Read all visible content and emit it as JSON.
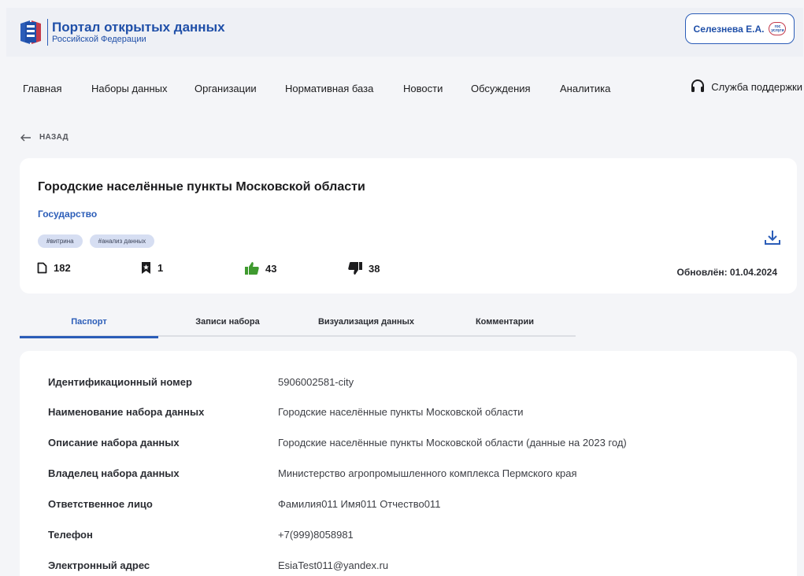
{
  "header": {
    "portal_title": "Портал открытых данных",
    "portal_subtitle": "Российской Федерации",
    "user_name": "Селезнева Е.А.",
    "gos_badge_text": "гос услуги"
  },
  "nav": {
    "items": [
      {
        "label": "Главная"
      },
      {
        "label": "Наборы данных"
      },
      {
        "label": "Организации"
      },
      {
        "label": "Нормативная база"
      },
      {
        "label": "Новости"
      },
      {
        "label": "Обсуждения"
      },
      {
        "label": "Аналитика"
      }
    ],
    "support_label": "Служба поддержки"
  },
  "back_label": "НАЗАД",
  "dataset": {
    "title": "Городские населённые пункты Московской области",
    "category": "Государство",
    "tags": [
      "#витрина",
      "#анализ данных"
    ],
    "stats": {
      "files": "182",
      "bookmarks": "1",
      "likes": "43",
      "dislikes": "38"
    },
    "updated": "Обновлён: 01.04.2024"
  },
  "tabs": [
    {
      "label": "Паспорт",
      "active": true
    },
    {
      "label": "Записи набора",
      "active": false
    },
    {
      "label": "Визуализация данных",
      "active": false
    },
    {
      "label": "Комментарии",
      "active": false
    }
  ],
  "passport": {
    "rows": [
      {
        "label": "Идентификационный номер",
        "value": "5906002581-city"
      },
      {
        "label": "Наименование набора данных",
        "value": "Городские населённые пункты Московской области"
      },
      {
        "label": "Описание набора данных",
        "value": "Городские населённые пункты Московской области (данные на 2023 год)"
      },
      {
        "label": "Владелец набора данных",
        "value": "Министерство агропромышленного комплекса Пермского края"
      },
      {
        "label": "Ответственное лицо",
        "value": "Фамилия011 Имя011 Отчество011"
      },
      {
        "label": "Телефон",
        "value": "+7(999)8058981"
      },
      {
        "label": "Электронный адрес",
        "value": "EsiaTest011@yandex.ru"
      }
    ]
  },
  "colors": {
    "brand_blue": "#2b5db8",
    "brand_red": "#c43a4b",
    "like_green": "#3f9a2f",
    "page_bg": "#f4f5f8"
  }
}
